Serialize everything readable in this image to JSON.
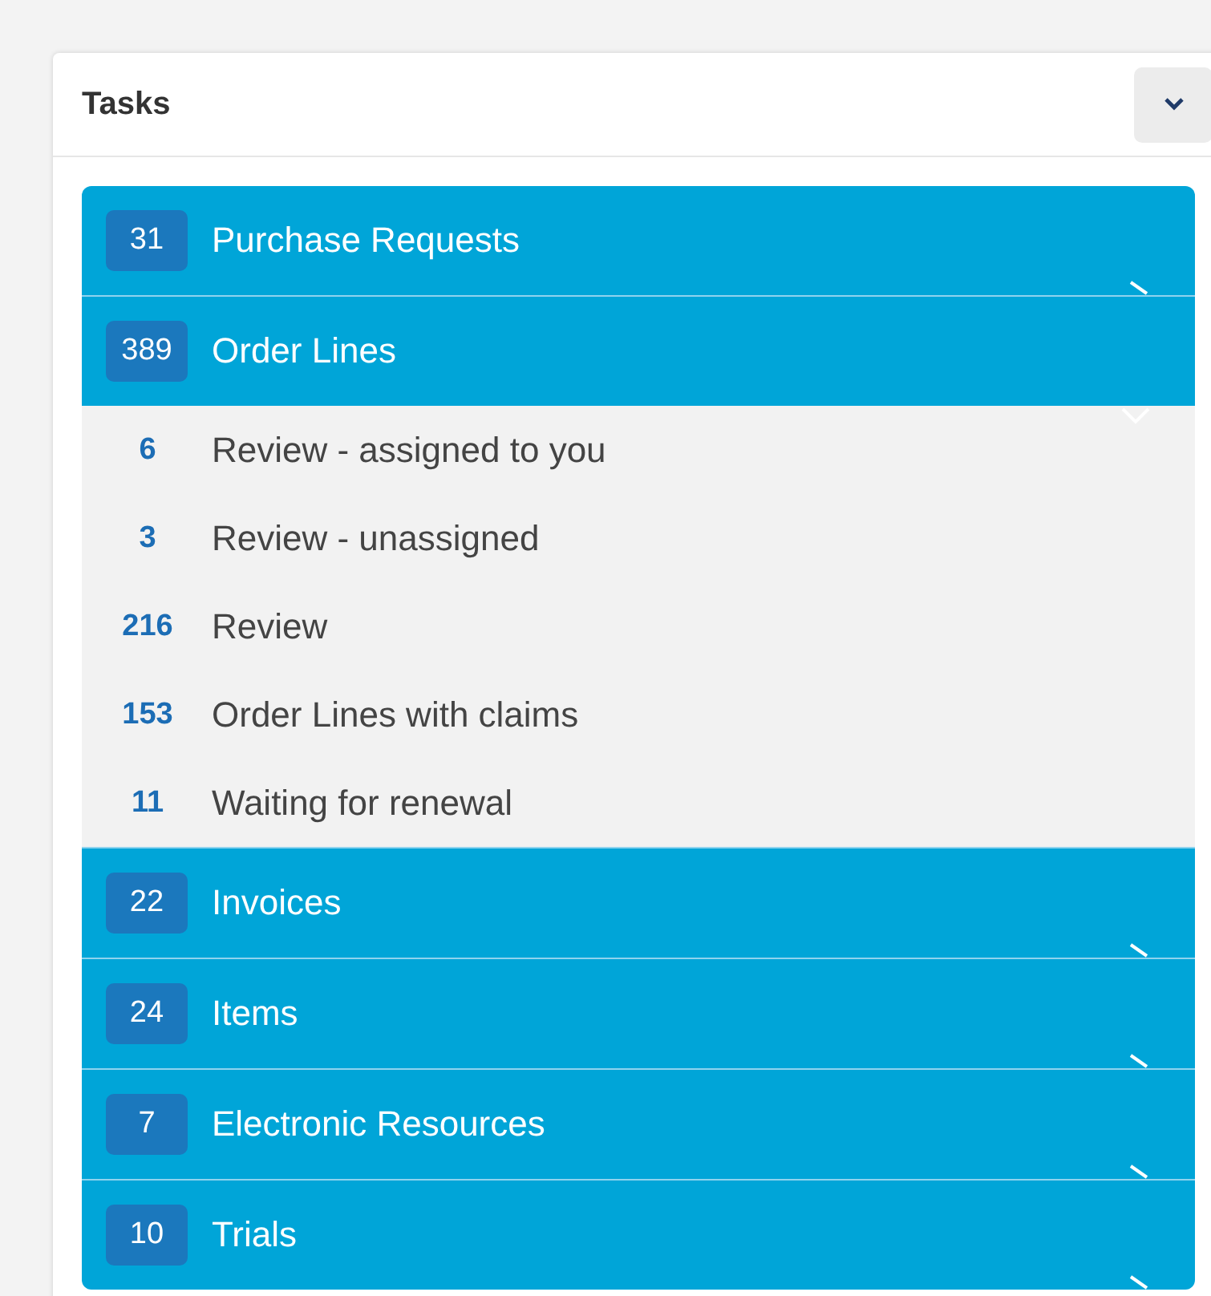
{
  "panel": {
    "title": "Tasks"
  },
  "groups": [
    {
      "count": "31",
      "label": "Purchase Requests",
      "expanded": false
    },
    {
      "count": "389",
      "label": "Order Lines",
      "expanded": true,
      "children": [
        {
          "count": "6",
          "label": "Review - assigned to you"
        },
        {
          "count": "3",
          "label": "Review - unassigned"
        },
        {
          "count": "216",
          "label": "Review"
        },
        {
          "count": "153",
          "label": "Order Lines with claims"
        },
        {
          "count": "11",
          "label": "Waiting for renewal"
        }
      ]
    },
    {
      "count": "22",
      "label": "Invoices",
      "expanded": false
    },
    {
      "count": "24",
      "label": "Items",
      "expanded": false
    },
    {
      "count": "7",
      "label": "Electronic Resources",
      "expanded": false
    },
    {
      "count": "10",
      "label": "Trials",
      "expanded": false
    }
  ]
}
